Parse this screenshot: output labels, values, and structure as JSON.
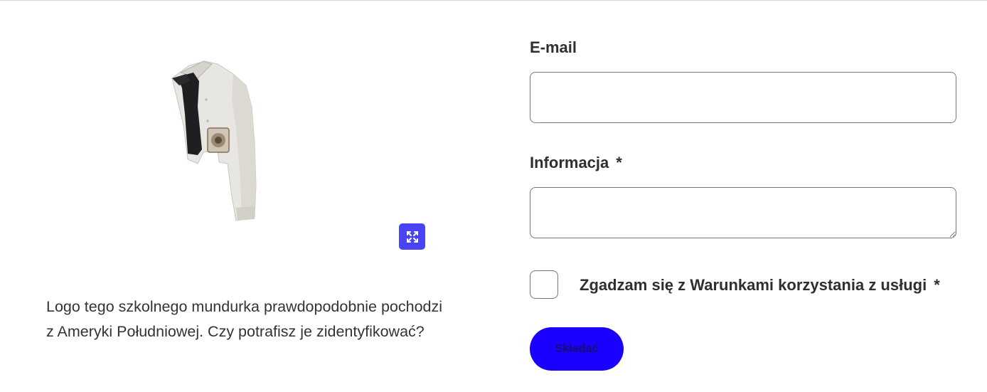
{
  "product": {
    "image_alt": "School uniform shirt with tie and patch",
    "expand_icon": "expand-arrows-icon",
    "description": "Logo tego szkolnego mundurka prawdopodobnie pochodzi z Ameryki Południowej. Czy potrafisz je zidentyfikować?"
  },
  "form": {
    "email_label": "E-mail",
    "email_value": "",
    "info_label": "Informacja",
    "info_value": "",
    "required_marker": "*",
    "consent_label": "Zgadzam się z Warunkami korzystania z usługi",
    "consent_checked": false,
    "submit_label": "Składać"
  },
  "colors": {
    "accent": "#4a42f5",
    "submit_bg": "#1a00ff",
    "submit_text": "#14116e",
    "text": "#2f2f2f",
    "border": "#777777"
  }
}
